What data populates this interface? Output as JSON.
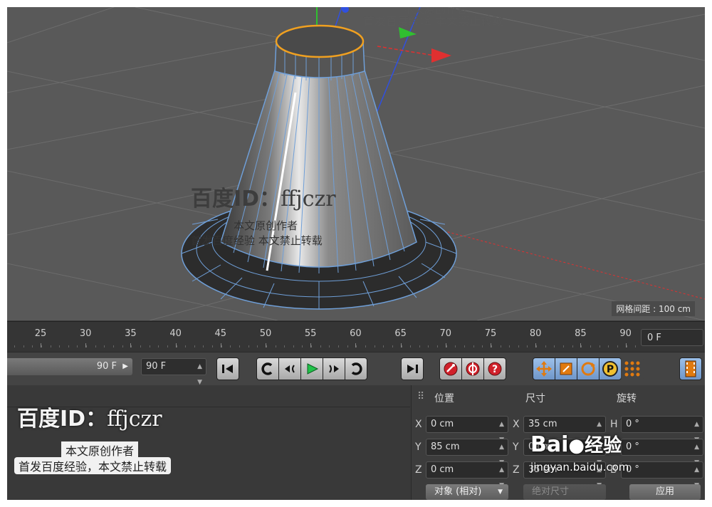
{
  "viewport": {
    "grid_spacing_label": "网格间距 : 100 cm"
  },
  "timeline": {
    "ticks": [
      "25",
      "30",
      "35",
      "40",
      "45",
      "50",
      "55",
      "60",
      "65",
      "70",
      "75",
      "80",
      "85",
      "90"
    ],
    "current_frame": "0 F"
  },
  "transport": {
    "preview_max": "90 F",
    "end_frame": "90 F"
  },
  "attributes": {
    "headers": {
      "position": "位置",
      "size": "尺寸",
      "rotation": "旋转"
    },
    "rows": [
      {
        "axis": "X",
        "position": "0 cm",
        "size_axis": "X",
        "size": "35 cm",
        "rot_axis": "H",
        "rotation": "0 °"
      },
      {
        "axis": "Y",
        "position": "85 cm",
        "size_axis": "Y",
        "size": "0 cm",
        "rot_axis": "P",
        "rotation": "0 °"
      },
      {
        "axis": "Z",
        "position": "0 cm",
        "size_axis": "Z",
        "size": "35 cm",
        "rot_axis": "B",
        "rotation": "0 °"
      }
    ],
    "coord_mode": "对象 (相对)",
    "size_mode": "绝对尺寸",
    "apply_label": "应用"
  },
  "watermark": {
    "id_prefix": "百度ID：",
    "id_user": "ffjczr",
    "line1": "本文原创作者",
    "line2": "首发百度经验，本文禁止转载",
    "line2_spaced": "首发百度经验  本文禁止转载"
  },
  "brand": {
    "logo_text": "Bai",
    "logo_cn": "经验",
    "url": "jingyan.baidu.com"
  },
  "colors": {
    "viewport_bg": "#595959",
    "wire": "#6f9fd8",
    "selection": "#f0a020",
    "axis_x": "#e03030",
    "axis_y": "#30c030",
    "axis_z": "#3050e0",
    "tool_active": "#8fb5e4"
  }
}
